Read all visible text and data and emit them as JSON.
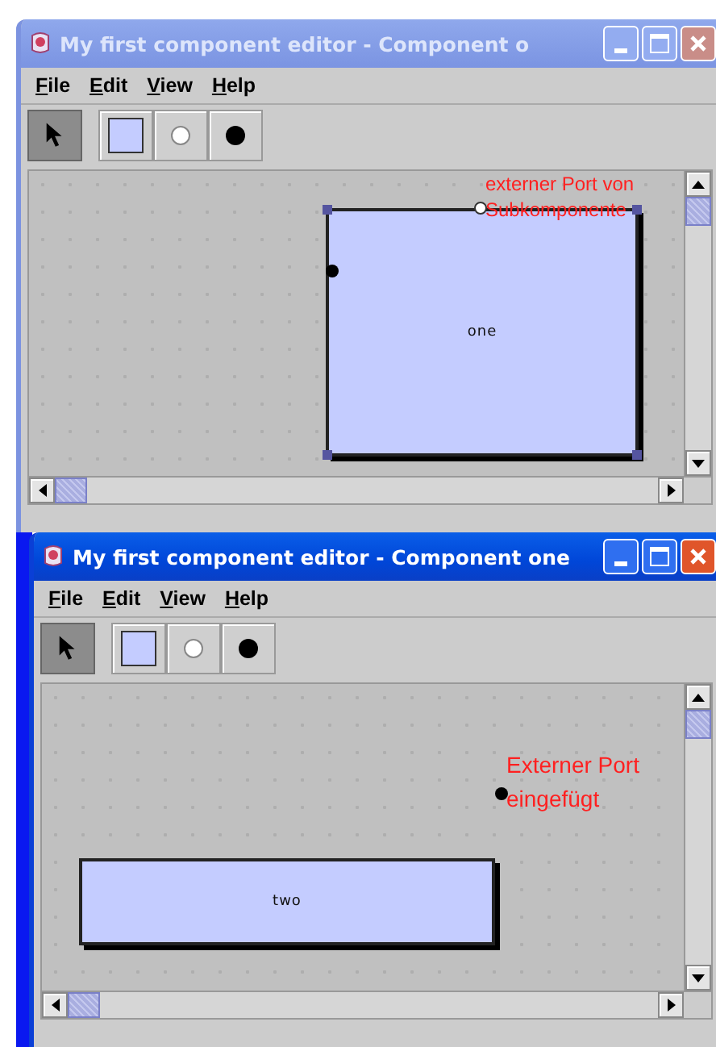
{
  "windows": [
    {
      "title": "My first component editor - Component o",
      "active": false,
      "menu": [
        {
          "label": "File"
        },
        {
          "label": "Edit"
        },
        {
          "label": "View"
        },
        {
          "label": "Help"
        }
      ],
      "tools": [
        {
          "kind": "select",
          "selected": true
        },
        {
          "kind": "component",
          "selected": false
        },
        {
          "kind": "hollow-port",
          "selected": false
        },
        {
          "kind": "filled-port",
          "selected": false
        }
      ],
      "components": [
        {
          "label": "one",
          "selected": true
        }
      ],
      "ports": [
        {
          "kind": "filled"
        },
        {
          "kind": "hollow"
        }
      ],
      "notes": [
        "externer Port von",
        "Subkomponente"
      ]
    },
    {
      "title": "My first component editor - Component one",
      "active": true,
      "menu": [
        {
          "label": "File"
        },
        {
          "label": "Edit"
        },
        {
          "label": "View"
        },
        {
          "label": "Help"
        }
      ],
      "tools": [
        {
          "kind": "select",
          "selected": true
        },
        {
          "kind": "component",
          "selected": false
        },
        {
          "kind": "hollow-port",
          "selected": false
        },
        {
          "kind": "filled-port",
          "selected": false
        }
      ],
      "components": [
        {
          "label": "two",
          "selected": false
        }
      ],
      "ports": [
        {
          "kind": "filled"
        }
      ],
      "notes": [
        "Externer Port",
        "eingefügt"
      ]
    }
  ]
}
